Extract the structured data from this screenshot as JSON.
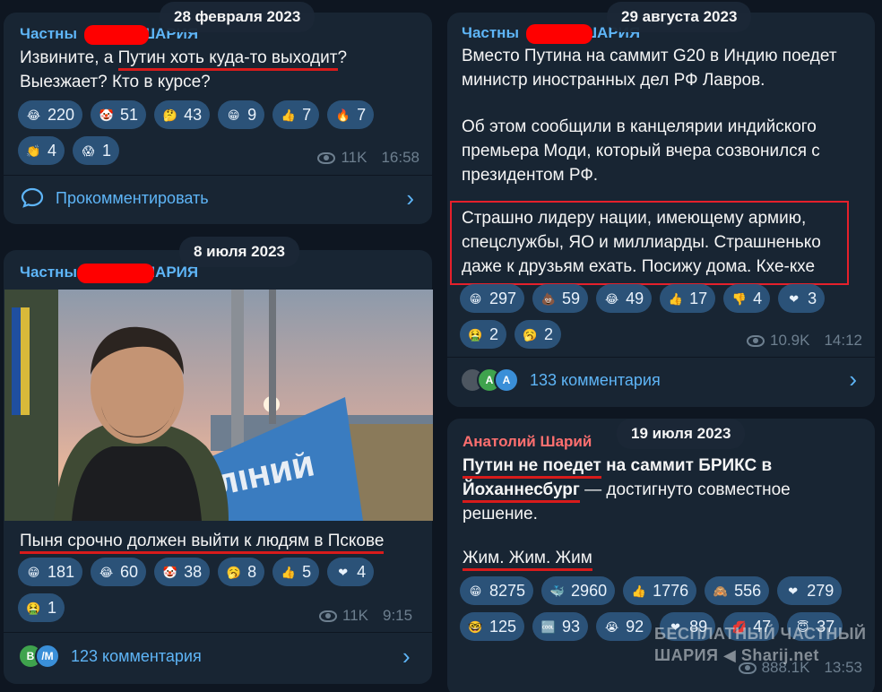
{
  "colors": {
    "background": "#0e1621",
    "bubble": "#182533",
    "accent": "#5eb5f7",
    "reaction_chip": "#2b5278",
    "underline": "#d81b1b"
  },
  "post1": {
    "date": "28 февраля 2023",
    "author_left": "Частны",
    "author_right": "ШАРИЯ",
    "text_pre": "Извините, а ",
    "text_hl": "Путин хоть куда-то выходит",
    "text_post": "? Выезжает? Кто в курсе?",
    "reactions": [
      {
        "icon": "rofl-emoji",
        "glyph": "😂",
        "count": "220"
      },
      {
        "icon": "clown-emoji",
        "glyph": "🤡",
        "count": "51"
      },
      {
        "icon": "thinking-emoji",
        "glyph": "🤔",
        "count": "43"
      },
      {
        "icon": "grin-emoji",
        "glyph": "😁",
        "count": "9"
      },
      {
        "icon": "thumbs-up-emoji",
        "glyph": "👍",
        "count": "7"
      },
      {
        "icon": "fire-emoji",
        "glyph": "🔥",
        "count": "7"
      },
      {
        "icon": "clap-emoji",
        "glyph": "👏",
        "count": "4"
      },
      {
        "icon": "scream-emoji",
        "glyph": "😱",
        "count": "1"
      }
    ],
    "views": "11K",
    "time": "16:58",
    "comment_label": "Прокомментировать"
  },
  "post2": {
    "date": "8 июля 2023",
    "author_left": "Частны",
    "author_right": "ШАРИЯ",
    "photo_sign": "ІЛІНИЙ",
    "text": "Пыня срочно должен выйти к людям в Пскове",
    "reactions": [
      {
        "icon": "grin-emoji",
        "glyph": "😁",
        "count": "181"
      },
      {
        "icon": "rofl-emoji",
        "glyph": "😂",
        "count": "60"
      },
      {
        "icon": "clown-emoji",
        "glyph": "🤡",
        "count": "38"
      },
      {
        "icon": "yawn-emoji",
        "glyph": "🥱",
        "count": "8"
      },
      {
        "icon": "thumbs-up-emoji",
        "glyph": "👍",
        "count": "5"
      },
      {
        "icon": "heart-emoji",
        "glyph": "❤",
        "count": "4"
      },
      {
        "icon": "vomit-emoji",
        "glyph": "🤮",
        "count": "1"
      }
    ],
    "views": "11K",
    "time": "9:15",
    "avatars": [
      "В",
      "/М"
    ],
    "comment_label": "123 комментария"
  },
  "post3": {
    "date": "29 августа 2023",
    "author_left": "Частны",
    "author_right": "ШАРИЯ",
    "para1": "Вместо Путина на саммит G20 в Индию поедет министр иностранных дел РФ Лавров.",
    "para2": "Об этом сообщили в канцелярии индийского премьера Моди, который вчера созвонился с президентом РФ.",
    "para3": "Страшно лидеру нации, имеющему армию, спецслужбы, ЯО и миллиарды. Страшненько даже к друзьям ехать. Посижу дома. Кхе-кхе",
    "reactions": [
      {
        "icon": "grin-emoji",
        "glyph": "😁",
        "count": "297"
      },
      {
        "icon": "poop-emoji",
        "glyph": "💩",
        "count": "59"
      },
      {
        "icon": "rofl-emoji",
        "glyph": "😂",
        "count": "49"
      },
      {
        "icon": "thumbs-up-emoji",
        "glyph": "👍",
        "count": "17"
      },
      {
        "icon": "thumbs-down-emoji",
        "glyph": "👎",
        "count": "4"
      },
      {
        "icon": "heart-emoji",
        "glyph": "❤",
        "count": "3"
      },
      {
        "icon": "vomit-emoji",
        "glyph": "🤮",
        "count": "2"
      },
      {
        "icon": "yawn-emoji",
        "glyph": "🥱",
        "count": "2"
      }
    ],
    "views": "10.9K",
    "time": "14:12",
    "avatars": [
      "",
      "A",
      "A"
    ],
    "comment_label": "133 комментария"
  },
  "post4": {
    "date": "19 июля 2023",
    "author": "Анатолий Шарий",
    "hl1": "Путин не поедет",
    "t1": " на саммит БРИКС в ",
    "hl2": "Йоханнесбург",
    "t2": " — достигнуто совместное решение.",
    "hl3": "Жим. Жим. Жим",
    "reactions": [
      {
        "icon": "grin-emoji",
        "glyph": "😁",
        "count": "8275"
      },
      {
        "icon": "whale-emoji",
        "glyph": "🐳",
        "count": "2960"
      },
      {
        "icon": "thumbs-up-emoji",
        "glyph": "👍",
        "count": "1776"
      },
      {
        "icon": "monkey-emoji",
        "glyph": "🙈",
        "count": "556"
      },
      {
        "icon": "heart-emoji",
        "glyph": "❤",
        "count": "279"
      },
      {
        "icon": "nerd-emoji",
        "glyph": "🤓",
        "count": "125"
      },
      {
        "icon": "cool-emoji",
        "glyph": "🆒",
        "count": "93"
      },
      {
        "icon": "sob-emoji",
        "glyph": "😭",
        "count": "92"
      },
      {
        "icon": "heart-fire-emoji",
        "glyph": "❤",
        "count": "89"
      },
      {
        "icon": "kiss-emoji",
        "glyph": "💋",
        "count": "47"
      },
      {
        "icon": "angel-emoji",
        "glyph": "😇",
        "count": "37"
      }
    ],
    "views": "888.1K",
    "time": "13:53"
  },
  "watermark": {
    "line1": "БЕСПЛАТНЫЙ ЧАСТНЫЙ",
    "line2a": "ШАРИЯ",
    "line2b": "Sharij.net"
  }
}
